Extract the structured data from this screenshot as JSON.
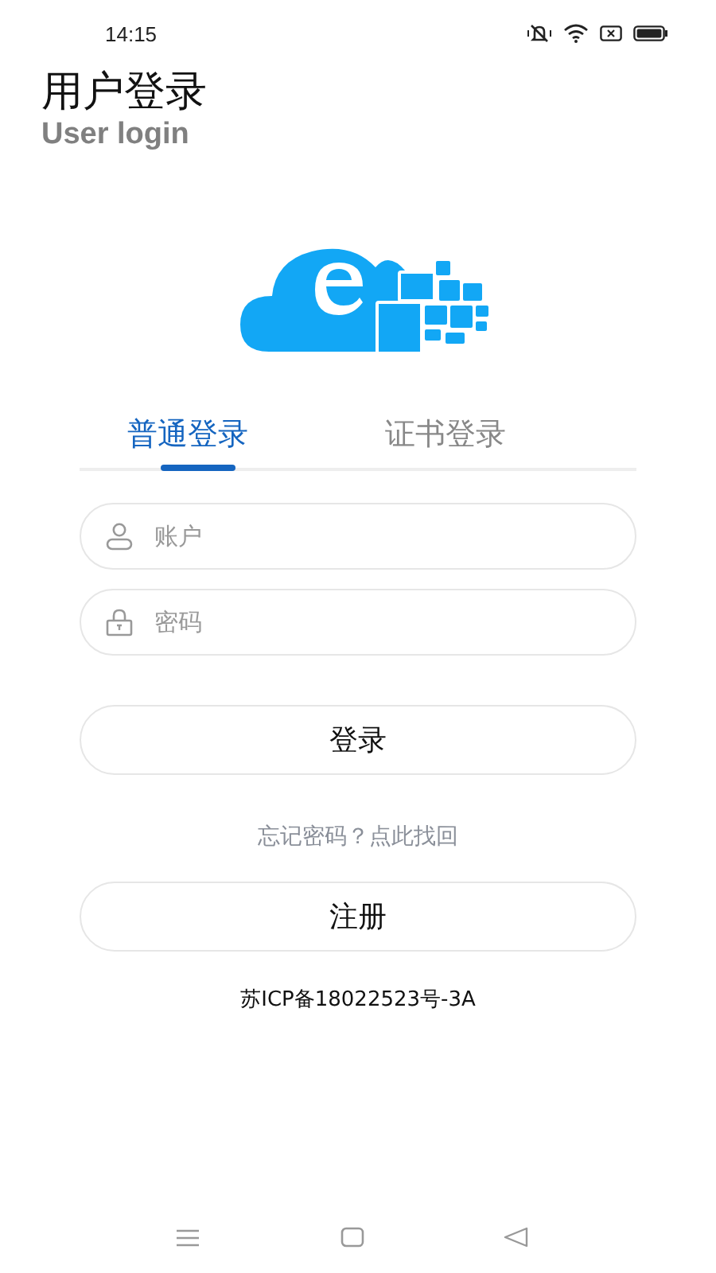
{
  "status_bar": {
    "time": "14:15"
  },
  "header": {
    "title": "用户登录",
    "subtitle": "User login"
  },
  "tabs": [
    {
      "label": "普通登录",
      "selected": true
    },
    {
      "label": "证书登录",
      "selected": false
    }
  ],
  "fields": [
    {
      "kind": "user",
      "placeholder": "账户"
    },
    {
      "kind": "lock",
      "placeholder": "密码"
    }
  ],
  "login_button": "登录",
  "forgot_link": "忘记密码？点此找回",
  "register_button": "注册",
  "icp": "苏ICP备18022523号-3A"
}
